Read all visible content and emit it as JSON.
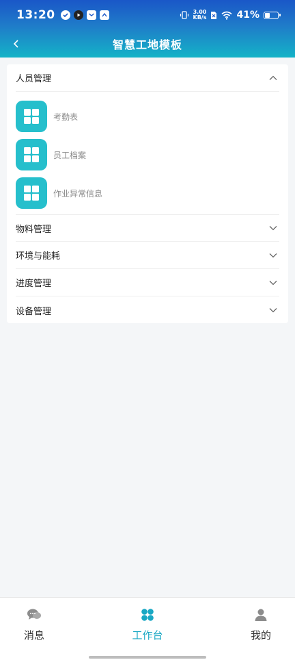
{
  "status_bar": {
    "time": "13:20",
    "speed_value": "3.00",
    "speed_unit": "KB/s",
    "battery_percent": "41%",
    "battery_level": 0.41
  },
  "header": {
    "title": "智慧工地模板",
    "back_icon": "chevron-left-icon"
  },
  "sections": [
    {
      "title": "人员管理",
      "expanded": true,
      "items": [
        {
          "label": "考勤表",
          "icon": "grid-icon"
        },
        {
          "label": "员工档案",
          "icon": "grid-icon"
        },
        {
          "label": "作业异常信息",
          "icon": "grid-icon"
        }
      ]
    },
    {
      "title": "物料管理",
      "expanded": false
    },
    {
      "title": "环境与能耗",
      "expanded": false
    },
    {
      "title": "进度管理",
      "expanded": false
    },
    {
      "title": "设备管理",
      "expanded": false
    }
  ],
  "bottom_nav": {
    "items": [
      {
        "label": "消息",
        "icon": "chat-bubbles-icon",
        "active": false
      },
      {
        "label": "工作台",
        "icon": "clover-icon",
        "active": true
      },
      {
        "label": "我的",
        "icon": "person-icon",
        "active": false
      }
    ]
  },
  "colors": {
    "header_start": "#1a57c8",
    "header_end": "#14b3c7",
    "tile": "#26bfcc",
    "active_nav": "#1aa8c4"
  }
}
